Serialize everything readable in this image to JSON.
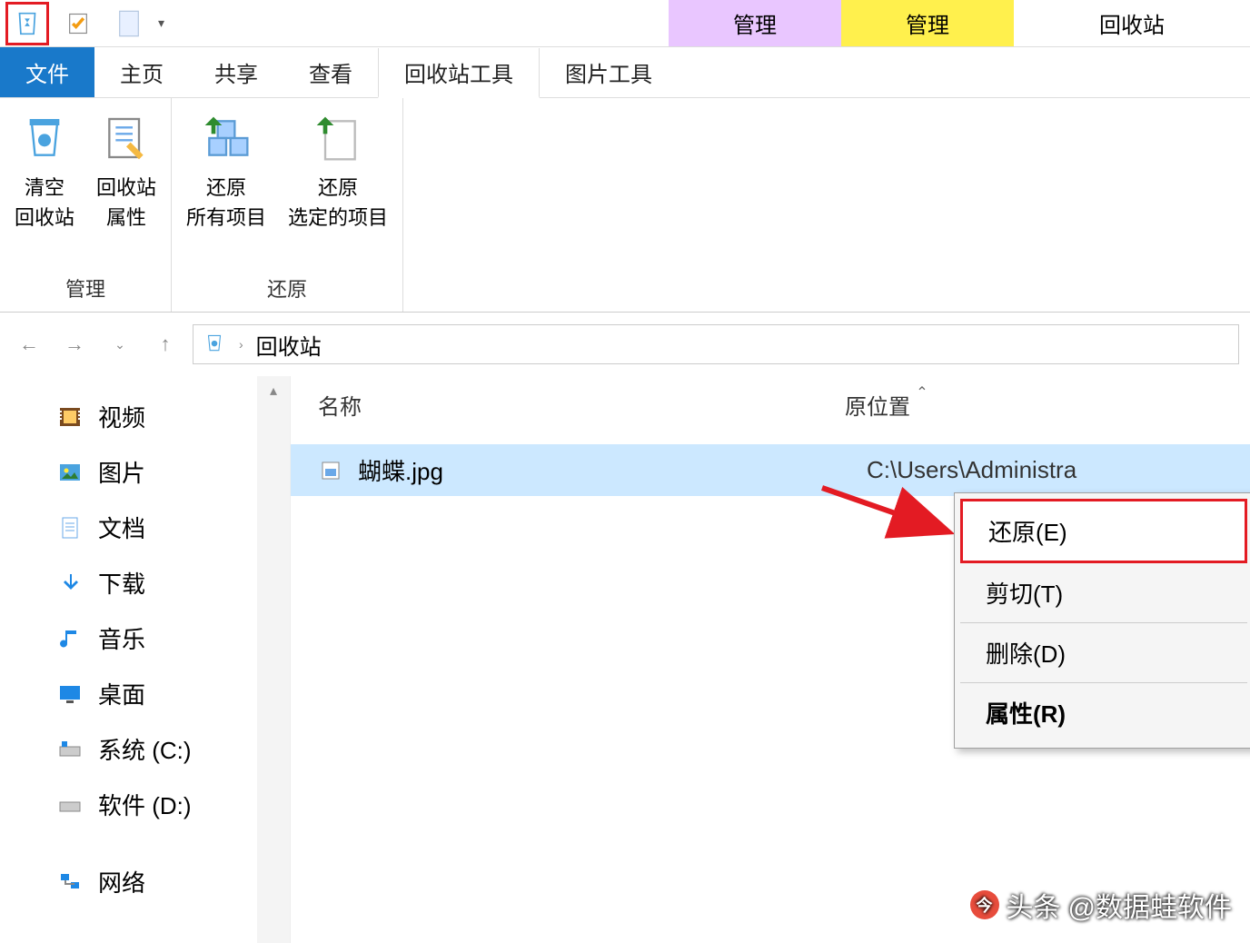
{
  "titlebar": {
    "manage1": "管理",
    "manage2": "管理",
    "location": "回收站"
  },
  "ribbon_tabs": {
    "file": "文件",
    "home": "主页",
    "share": "共享",
    "view": "查看",
    "recycle_tools": "回收站工具",
    "image_tools": "图片工具"
  },
  "ribbon": {
    "empty_bin": "清空\n回收站",
    "bin_props": "回收站\n属性",
    "restore_all": "还原\n所有项目",
    "restore_selected": "还原\n选定的项目",
    "group_manage": "管理",
    "group_restore": "还原"
  },
  "breadcrumb": {
    "location": "回收站"
  },
  "sidebar": {
    "items": [
      {
        "label": "视频",
        "icon": "video"
      },
      {
        "label": "图片",
        "icon": "picture"
      },
      {
        "label": "文档",
        "icon": "document"
      },
      {
        "label": "下载",
        "icon": "download"
      },
      {
        "label": "音乐",
        "icon": "music"
      },
      {
        "label": "桌面",
        "icon": "desktop"
      },
      {
        "label": "系统 (C:)",
        "icon": "drive-c"
      },
      {
        "label": "软件 (D:)",
        "icon": "drive-d"
      },
      {
        "label": "网络",
        "icon": "network"
      }
    ]
  },
  "columns": {
    "name": "名称",
    "location": "原位置"
  },
  "file": {
    "name": "蝴蝶.jpg",
    "location": "C:\\Users\\Administra"
  },
  "context_menu": {
    "restore": "还原(E)",
    "cut": "剪切(T)",
    "delete": "删除(D)",
    "properties": "属性(R)"
  },
  "watermark": {
    "prefix": "头条",
    "handle": "@数据蛙软件"
  }
}
